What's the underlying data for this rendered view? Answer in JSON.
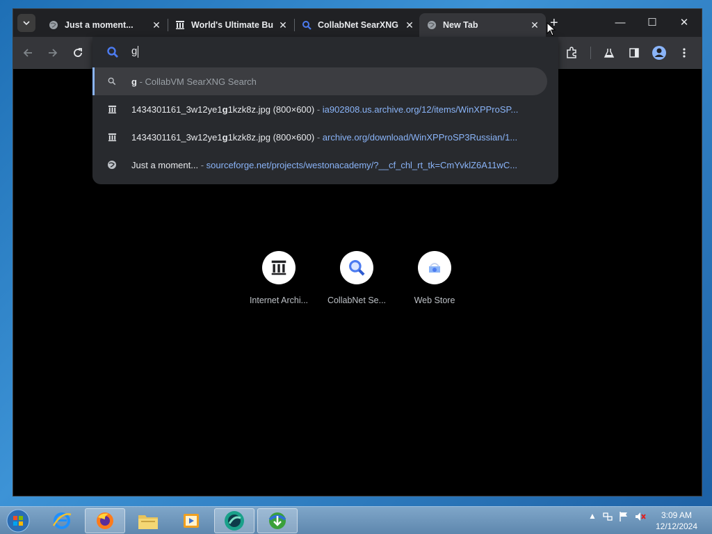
{
  "browser": {
    "tabs": [
      {
        "title": "Just a moment...",
        "favicon": "globe-icon",
        "active": false
      },
      {
        "title": "World's Ultimate Bu",
        "favicon": "archive-icon",
        "active": false
      },
      {
        "title": "CollabNet SearXNG",
        "favicon": "search-icon",
        "active": false
      },
      {
        "title": "New Tab",
        "favicon": "globe-icon",
        "active": true
      }
    ],
    "tab_close_glyph": "✕",
    "new_tab_glyph": "+",
    "window_controls": {
      "minimize": "—",
      "maximize": "☐",
      "close": "✕"
    }
  },
  "omnibox": {
    "query": "g",
    "suggestions": [
      {
        "icon": "search-icon",
        "main_bold": "g",
        "main_rest": "",
        "separator": " - ",
        "desc": "CollabVM SearXNG Search",
        "desc_type": "dim"
      },
      {
        "icon": "archive-icon",
        "main_pre": "1434301161_3w12ye1",
        "main_bold": "g",
        "main_rest": "1kzk8z.jpg (800×600)",
        "separator": " - ",
        "desc": "ia902808.us.archive.org/12/items/WinXPProSP...",
        "desc_type": "url"
      },
      {
        "icon": "archive-icon",
        "main_pre": "1434301161_3w12ye1",
        "main_bold": "g",
        "main_rest": "1kzk8z.jpg (800×600)",
        "separator": " - ",
        "desc": "archive.org/download/WinXPProSP3Russian/1...",
        "desc_type": "url"
      },
      {
        "icon": "globe-icon",
        "main_pre": "Just a moment...",
        "main_bold": "",
        "main_rest": "",
        "separator": " - ",
        "desc": "sourceforge.net/projects/westonacademy/?__cf_chl_rt_tk=CmYvklZ6A11wC...",
        "desc_type": "url"
      }
    ]
  },
  "shortcuts": [
    {
      "label": "Internet Archi...",
      "icon": "archive-icon"
    },
    {
      "label": "CollabNet Se...",
      "icon": "search-icon"
    },
    {
      "label": "Web Store",
      "icon": "webstore-icon"
    }
  ],
  "taskbar": {
    "items": [
      "start-orb-icon",
      "internet-explorer-icon",
      "firefox-icon",
      "file-explorer-icon",
      "media-player-icon",
      "chrome-icon",
      "download-manager-icon"
    ],
    "clock_time": "3:09 AM",
    "clock_date": "12/12/2024"
  },
  "colors": {
    "accent": "#8ab4f8",
    "tabstrip": "#202124",
    "toolbar": "#35363a",
    "dropdown": "#282a2e"
  }
}
